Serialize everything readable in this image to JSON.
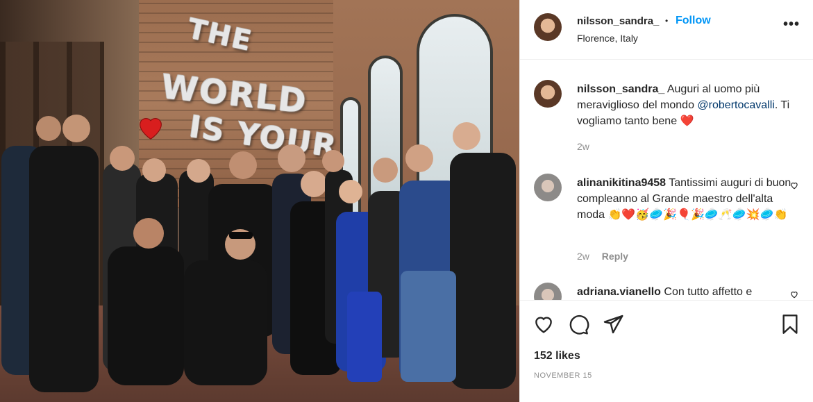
{
  "header": {
    "username": "nilsson_sandra_",
    "separator": "•",
    "follow_label": "Follow",
    "location": "Florence, Italy",
    "more_icon": "more-horizontal-icon"
  },
  "photo": {
    "balloon_line1": "THE",
    "balloon_line2": "WORLD",
    "balloon_line3": "IS YOUR"
  },
  "comments": [
    {
      "username": "nilsson_sandra_",
      "text_before": " Auguri al uomo più meraviglioso del mondo ",
      "mention": "@robertocavalli",
      "text_after": ". Ti vogliamo tanto bene ❤️",
      "time": "2w"
    },
    {
      "username": "alinanikitina9458",
      "text": " Tantissimi auguri di buon compleanno al Grande maestro dell'alta moda 👏❤️🥳🥏🎉🎈🎉🥏🥂🥏💥🥏👏",
      "time": "2w",
      "reply_label": "Reply"
    },
    {
      "username": "adriana.vianello",
      "text": " Con tutto affetto e"
    }
  ],
  "actions": {
    "likes_text": "152 likes",
    "date": "NOVEMBER 15"
  },
  "colors": {
    "follow": "#0095f6",
    "mention": "#00376b",
    "secondary_text": "#8e8e8e",
    "heart": "#ed4956"
  }
}
